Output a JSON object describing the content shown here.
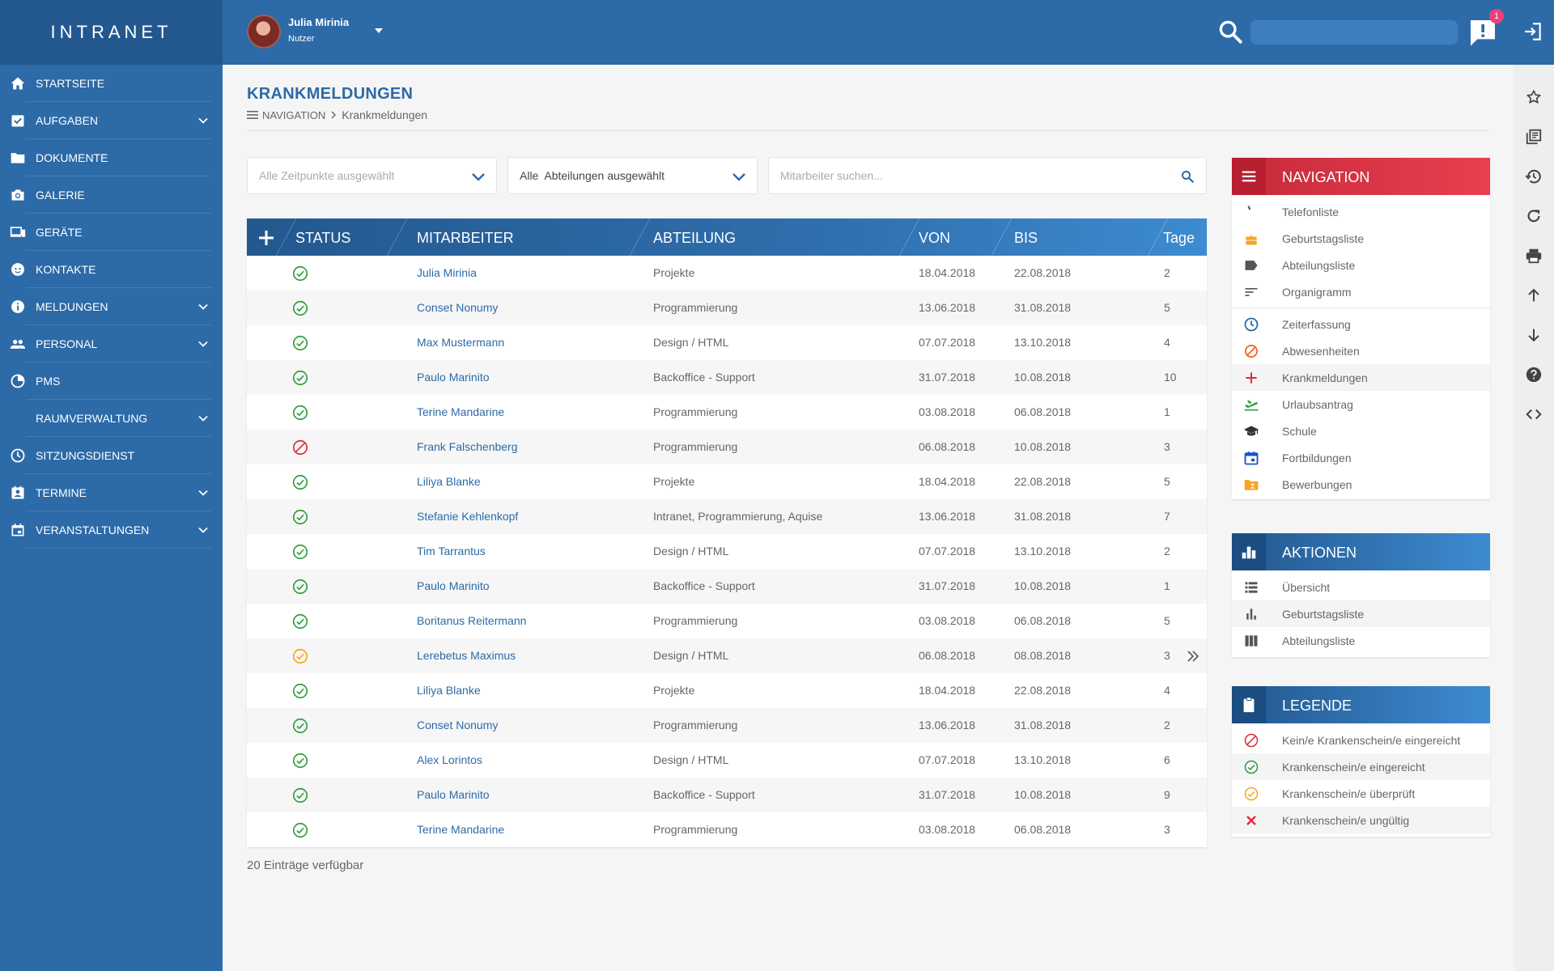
{
  "app": {
    "logo": "INTRANET"
  },
  "sidebar": {
    "items": [
      {
        "label": "STARTSEITE",
        "icon": "home-icon",
        "expandable": false
      },
      {
        "label": "AUFGABEN",
        "icon": "task-check-icon",
        "expandable": true
      },
      {
        "label": "DOKUMENTE",
        "icon": "folder-icon",
        "expandable": false
      },
      {
        "label": "GALERIE",
        "icon": "camera-icon",
        "expandable": false
      },
      {
        "label": "GERÄTE",
        "icon": "devices-icon",
        "expandable": false
      },
      {
        "label": "KONTAKTE",
        "icon": "face-icon",
        "expandable": false
      },
      {
        "label": "MELDUNGEN",
        "icon": "info-icon",
        "expandable": true
      },
      {
        "label": "PERSONAL",
        "icon": "people-icon",
        "expandable": true
      },
      {
        "label": "PMS",
        "icon": "pie-chart-icon",
        "expandable": false
      },
      {
        "label": "RAUMVERWALTUNG",
        "icon": "location-pin-icon",
        "expandable": true
      },
      {
        "label": "SITZUNGSDIENST",
        "icon": "clock-icon",
        "expandable": false
      },
      {
        "label": "TERMINE",
        "icon": "contact-card-icon",
        "expandable": true
      },
      {
        "label": "VERANSTALTUNGEN",
        "icon": "event-calendar-icon",
        "expandable": true
      }
    ]
  },
  "header": {
    "user_name": "Julia Mirinia",
    "user_role": "Nutzer",
    "notification_count": "1",
    "search_value": ""
  },
  "page": {
    "title": "KRANKMELDUNGEN",
    "breadcrumb": [
      "NAVIGATION",
      "Krankmeldungen"
    ]
  },
  "filters": {
    "time": "Alle Zeitpunkte ausgewählt",
    "department": "Alle  Abteilungen ausgewählt",
    "search_placeholder": "Mitarbeiter suchen..."
  },
  "table": {
    "columns": [
      "STATUS",
      "MITARBEITER",
      "ABTEILUNG",
      "VON",
      "BIS",
      "Tage"
    ],
    "rows": [
      {
        "status": "eingereicht",
        "name": "Julia Mirinia",
        "dept": "Projekte",
        "from": "18.04.2018",
        "to": "22.08.2018",
        "days": "2"
      },
      {
        "status": "eingereicht",
        "name": "Conset Nonumy",
        "dept": "Programmierung",
        "from": "13.06.2018",
        "to": "31.08.2018",
        "days": "5"
      },
      {
        "status": "eingereicht",
        "name": "Max Mustermann",
        "dept": "Design / HTML",
        "from": "07.07.2018",
        "to": "13.10.2018",
        "days": "4"
      },
      {
        "status": "eingereicht",
        "name": "Paulo Marinito",
        "dept": "Backoffice - Support",
        "from": "31.07.2018",
        "to": "10.08.2018",
        "days": "10"
      },
      {
        "status": "eingereicht",
        "name": "Terine Mandarine",
        "dept": "Programmierung",
        "from": "03.08.2018",
        "to": "06.08.2018",
        "days": "1"
      },
      {
        "status": "kein",
        "name": "Frank Falschenberg",
        "dept": "Programmierung",
        "from": "06.08.2018",
        "to": "10.08.2018",
        "days": "3"
      },
      {
        "status": "eingereicht",
        "name": "Liliya Blanke",
        "dept": "Projekte",
        "from": "18.04.2018",
        "to": "22.08.2018",
        "days": "5"
      },
      {
        "status": "eingereicht",
        "name": "Stefanie Kehlenkopf",
        "dept": "Intranet, Programmierung, Aquise",
        "from": "13.06.2018",
        "to": "31.08.2018",
        "days": "7"
      },
      {
        "status": "eingereicht",
        "name": "Tim Tarrantus",
        "dept": "Design / HTML",
        "from": "07.07.2018",
        "to": "13.10.2018",
        "days": "2"
      },
      {
        "status": "eingereicht",
        "name": "Paulo Marinito",
        "dept": "Backoffice - Support",
        "from": "31.07.2018",
        "to": "10.08.2018",
        "days": "1"
      },
      {
        "status": "eingereicht",
        "name": "Boritanus Reitermann",
        "dept": "Programmierung",
        "from": "03.08.2018",
        "to": "06.08.2018",
        "days": "5"
      },
      {
        "status": "ueberprueft",
        "name": "Lerebetus Maximus",
        "dept": "Design / HTML",
        "from": "06.08.2018",
        "to": "08.08.2018",
        "days": "3"
      },
      {
        "status": "eingereicht",
        "name": "Liliya Blanke",
        "dept": "Projekte",
        "from": "18.04.2018",
        "to": "22.08.2018",
        "days": "4"
      },
      {
        "status": "eingereicht",
        "name": "Conset Nonumy",
        "dept": "Programmierung",
        "from": "13.06.2018",
        "to": "31.08.2018",
        "days": "2"
      },
      {
        "status": "eingereicht",
        "name": "Alex Lorintos",
        "dept": "Design / HTML",
        "from": "07.07.2018",
        "to": "13.10.2018",
        "days": "6"
      },
      {
        "status": "eingereicht",
        "name": "Paulo Marinito",
        "dept": "Backoffice - Support",
        "from": "31.07.2018",
        "to": "10.08.2018",
        "days": "9"
      },
      {
        "status": "eingereicht",
        "name": "Terine Mandarine",
        "dept": "Programmierung",
        "from": "03.08.2018",
        "to": "06.08.2018",
        "days": "3"
      }
    ],
    "footer": "20 Einträge verfügbar"
  },
  "panels": {
    "navigation": {
      "title": "NAVIGATION",
      "groups": [
        [
          {
            "label": "Telefonliste",
            "icon": "phone-icon",
            "color": "#2c6aa8"
          },
          {
            "label": "Geburtstagsliste",
            "icon": "cake-icon",
            "color": "#f5a623"
          },
          {
            "label": "Abteilungsliste",
            "icon": "label-tag-icon",
            "color": "#555555"
          },
          {
            "label": "Organigramm",
            "icon": "sort-lines-icon",
            "color": "#555555"
          }
        ],
        [
          {
            "label": "Zeiterfassung",
            "icon": "clock-icon",
            "color": "#2c6aa8"
          },
          {
            "label": "Abwesenheiten",
            "icon": "block-icon",
            "color": "#f0642d"
          },
          {
            "label": "Krankmeldungen",
            "icon": "plus-cross-icon",
            "color": "#e02a3a",
            "active": true
          },
          {
            "label": "Urlaubsantrag",
            "icon": "airplane-takeoff-icon",
            "color": "#2e9e3e"
          },
          {
            "label": "Schule",
            "icon": "graduation-cap-icon",
            "color": "#333333"
          },
          {
            "label": "Fortbildungen",
            "icon": "calendar-icon",
            "color": "#1e50c8"
          },
          {
            "label": "Bewerbungen",
            "icon": "shared-folder-icon",
            "color": "#f5a623"
          }
        ]
      ]
    },
    "actions": {
      "title": "AKTIONEN",
      "items": [
        {
          "label": "Übersicht",
          "icon": "list-icon"
        },
        {
          "label": "Geburtstagsliste",
          "icon": "bar-chart-icon"
        },
        {
          "label": "Abteilungsliste",
          "icon": "columns-icon"
        }
      ]
    },
    "legend": {
      "title": "LEGENDE",
      "items": [
        {
          "label": "Kein/e Krankenschein/e eingereicht",
          "status": "kein"
        },
        {
          "label": "Krankenschein/e eingereicht",
          "status": "eingereicht"
        },
        {
          "label": "Krankenschein/e überprüft",
          "status": "ueberprueft"
        },
        {
          "label": "Krankenschein/e ungültig",
          "status": "ungueltig"
        }
      ]
    }
  },
  "toolbar": {
    "tools": [
      "star-icon",
      "library-books-icon",
      "history-icon",
      "refresh-icon",
      "print-icon",
      "arrow-up-icon",
      "arrow-down-icon",
      "help-icon",
      "code-icon"
    ]
  },
  "colors": {
    "primary": "#2c6aa8",
    "primary_dark": "#23588f",
    "status_ok": "#2e9e3e",
    "status_none": "#e02a3a",
    "status_checked": "#f5a623",
    "accent_red": "#e8404f"
  }
}
